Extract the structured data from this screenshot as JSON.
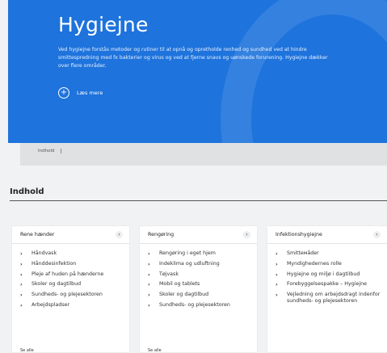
{
  "hero": {
    "title": "Hygiejne",
    "description": "Ved hygiejne forstås metoder og rutiner til at opnå og opretholde renhed og sundhed ved at hindre smittespredning med fx bakterier og virus og ved at fjerne snavs og uønskede forurening. Hygiejne dækker over flere områder.",
    "read_more": "Læs mere",
    "background": "#1e73dc"
  },
  "breadcrumb": {
    "label": "Indhold"
  },
  "section": {
    "title": "Indhold"
  },
  "cards": [
    {
      "title": "Rene hænder",
      "items": [
        "Håndvask",
        "Hånddesinfektion",
        "Pleje af huden på hænderne",
        "Skoler og dagtilbud",
        "Sundheds- og plejesektoren",
        "Arbejdspladser"
      ],
      "see_all": "Se alle"
    },
    {
      "title": "Rengøring",
      "items": [
        "Rengøring i eget hjem",
        "Indeklima og udluftning",
        "Tøjvask",
        "Mobil og tablets",
        "Skoler og dagtilbud",
        "Sundheds- og plejesektoren"
      ],
      "see_all": "Se alle"
    },
    {
      "title": "Infektionshygiejne",
      "items": [
        "Smitteмåder",
        "Myndighedernes rolle",
        "Hygiejne og miljø i dagtilbud",
        "Forebyggelsespakke – Hygiejne",
        "Vejledning om arbejdsdragt indenfor sundheds- og plejesektoren"
      ]
    }
  ],
  "icons": {
    "plus": "plus-circle-icon",
    "arrow": "chevron-right-icon",
    "bullet": "chevron-right-icon"
  }
}
